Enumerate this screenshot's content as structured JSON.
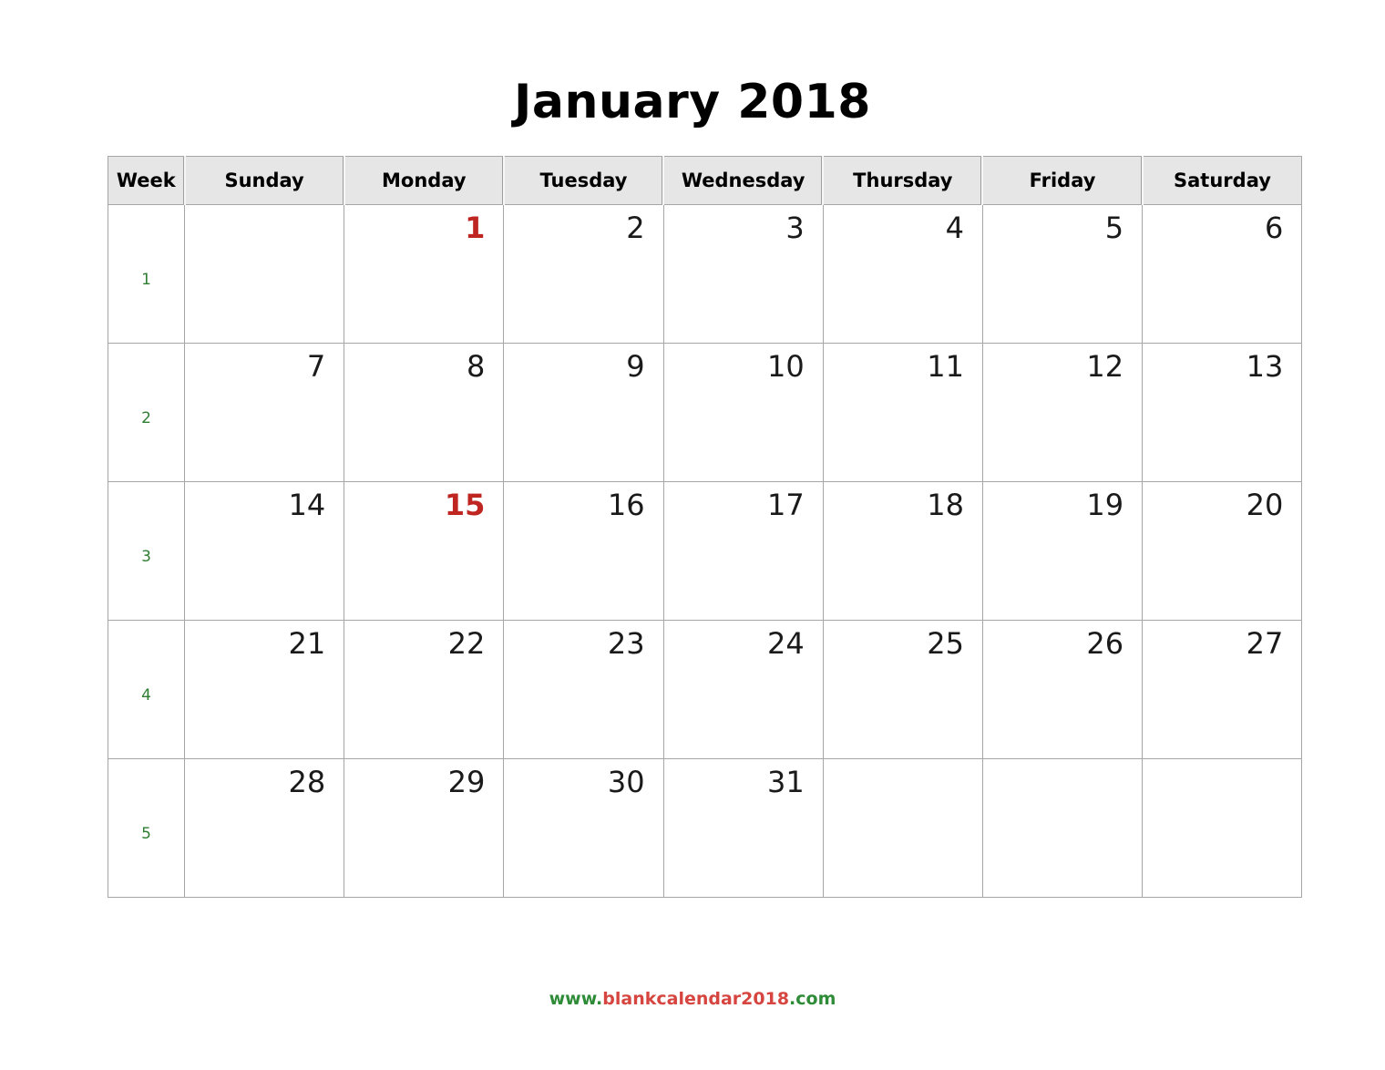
{
  "page": {
    "title": "January 2018",
    "month": "January",
    "year": "2018"
  },
  "colors": {
    "holiday_red": "#bf2521",
    "week_number_green": "#2e7d32",
    "header_background": "#e6e6e6",
    "border": "#a6a6a6",
    "day_number": "#1a1a1a",
    "footer_green": "#2e8b37",
    "footer_red": "#d6453f"
  },
  "table": {
    "headers": [
      "Week",
      "Sunday",
      "Monday",
      "Tuesday",
      "Wednesday",
      "Thursday",
      "Friday",
      "Saturday"
    ],
    "rows": [
      {
        "week": "1",
        "days": [
          {
            "label": "",
            "holiday": false,
            "empty": true
          },
          {
            "label": "1",
            "holiday": true,
            "empty": false
          },
          {
            "label": "2",
            "holiday": false,
            "empty": false
          },
          {
            "label": "3",
            "holiday": false,
            "empty": false
          },
          {
            "label": "4",
            "holiday": false,
            "empty": false
          },
          {
            "label": "5",
            "holiday": false,
            "empty": false
          },
          {
            "label": "6",
            "holiday": false,
            "empty": false
          }
        ]
      },
      {
        "week": "2",
        "days": [
          {
            "label": "7",
            "holiday": false,
            "empty": false
          },
          {
            "label": "8",
            "holiday": false,
            "empty": false
          },
          {
            "label": "9",
            "holiday": false,
            "empty": false
          },
          {
            "label": "10",
            "holiday": false,
            "empty": false
          },
          {
            "label": "11",
            "holiday": false,
            "empty": false
          },
          {
            "label": "12",
            "holiday": false,
            "empty": false
          },
          {
            "label": "13",
            "holiday": false,
            "empty": false
          }
        ]
      },
      {
        "week": "3",
        "days": [
          {
            "label": "14",
            "holiday": false,
            "empty": false
          },
          {
            "label": "15",
            "holiday": true,
            "empty": false
          },
          {
            "label": "16",
            "holiday": false,
            "empty": false
          },
          {
            "label": "17",
            "holiday": false,
            "empty": false
          },
          {
            "label": "18",
            "holiday": false,
            "empty": false
          },
          {
            "label": "19",
            "holiday": false,
            "empty": false
          },
          {
            "label": "20",
            "holiday": false,
            "empty": false
          }
        ]
      },
      {
        "week": "4",
        "days": [
          {
            "label": "21",
            "holiday": false,
            "empty": false
          },
          {
            "label": "22",
            "holiday": false,
            "empty": false
          },
          {
            "label": "23",
            "holiday": false,
            "empty": false
          },
          {
            "label": "24",
            "holiday": false,
            "empty": false
          },
          {
            "label": "25",
            "holiday": false,
            "empty": false
          },
          {
            "label": "26",
            "holiday": false,
            "empty": false
          },
          {
            "label": "27",
            "holiday": false,
            "empty": false
          }
        ]
      },
      {
        "week": "5",
        "days": [
          {
            "label": "28",
            "holiday": false,
            "empty": false
          },
          {
            "label": "29",
            "holiday": false,
            "empty": false
          },
          {
            "label": "30",
            "holiday": false,
            "empty": false
          },
          {
            "label": "31",
            "holiday": false,
            "empty": false
          },
          {
            "label": "",
            "holiday": false,
            "empty": true
          },
          {
            "label": "",
            "holiday": false,
            "empty": true
          },
          {
            "label": "",
            "holiday": false,
            "empty": true
          }
        ]
      }
    ]
  },
  "footer": {
    "prefix": "www.",
    "name": "blankcalendar2018",
    "suffix": ".com",
    "full": "www.blankcalendar2018.com"
  }
}
